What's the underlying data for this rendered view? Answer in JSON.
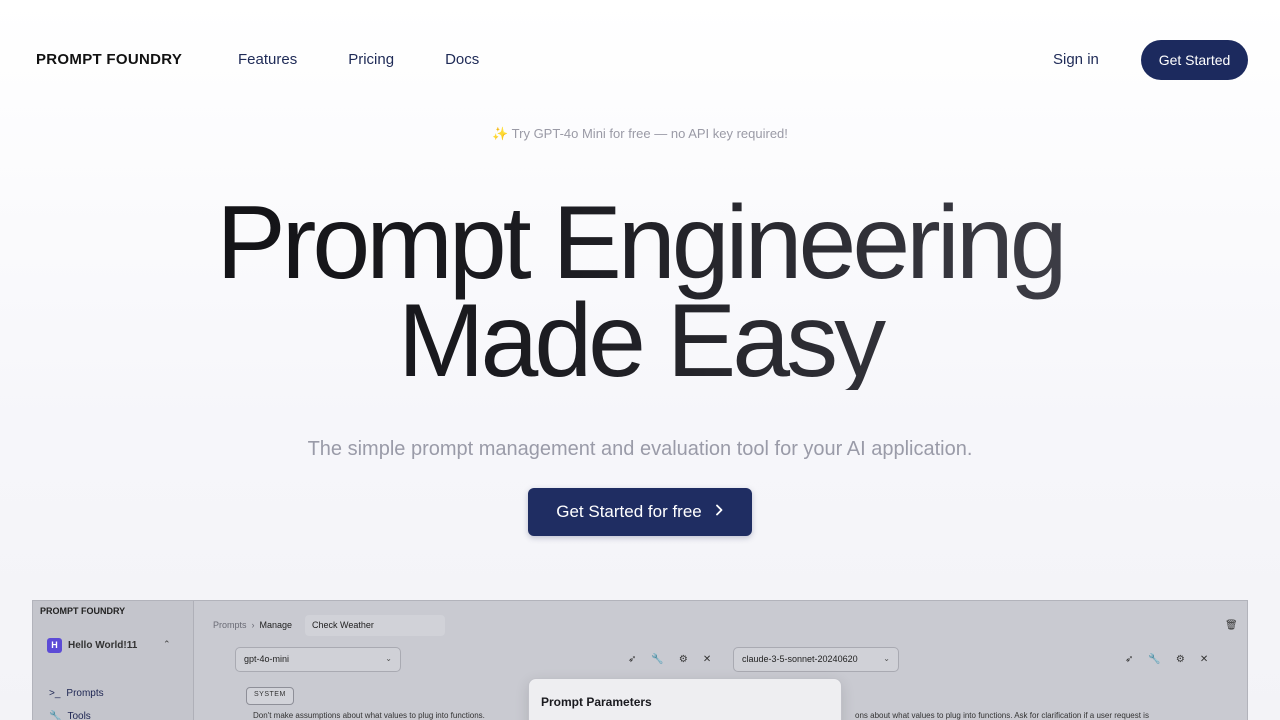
{
  "nav": {
    "brand": "PROMPT FOUNDRY",
    "links": [
      "Features",
      "Pricing",
      "Docs"
    ],
    "sign_in": "Sign in",
    "get_started": "Get Started"
  },
  "hero": {
    "announcement_icon": "✨",
    "announcement": "Try GPT-4o Mini for free — no API key required!",
    "headline_line1": "Prompt Engineering",
    "headline_line2": "Made Easy",
    "subheadline": "The simple prompt management and evaluation tool for your AI application.",
    "cta": "Get Started for free",
    "cta_icon": "chevron-right-icon"
  },
  "preview": {
    "brand": "PROMPT FOUNDRY",
    "workspace": "Hello World!11",
    "workspace_initial": "H",
    "sidebar": [
      {
        "icon": ">_",
        "label": "Prompts"
      },
      {
        "icon": "🔧",
        "label": "Tools"
      }
    ],
    "breadcrumb": [
      "Prompts",
      "Manage"
    ],
    "prompt_name": "Check Weather",
    "model_left": "gpt-4o-mini",
    "model_right": "claude-3-5-sonnet-20240620",
    "role_badge": "SYSTEM",
    "text_left": "Don't make assumptions about what values to plug into functions.",
    "text_right": "ons about what values to plug into functions. Ask for clarification if a user request is",
    "modal_title": "Prompt Parameters"
  },
  "colors": {
    "brand_navy": "#1c2a5e",
    "accent_purple": "#5c4bd6"
  }
}
